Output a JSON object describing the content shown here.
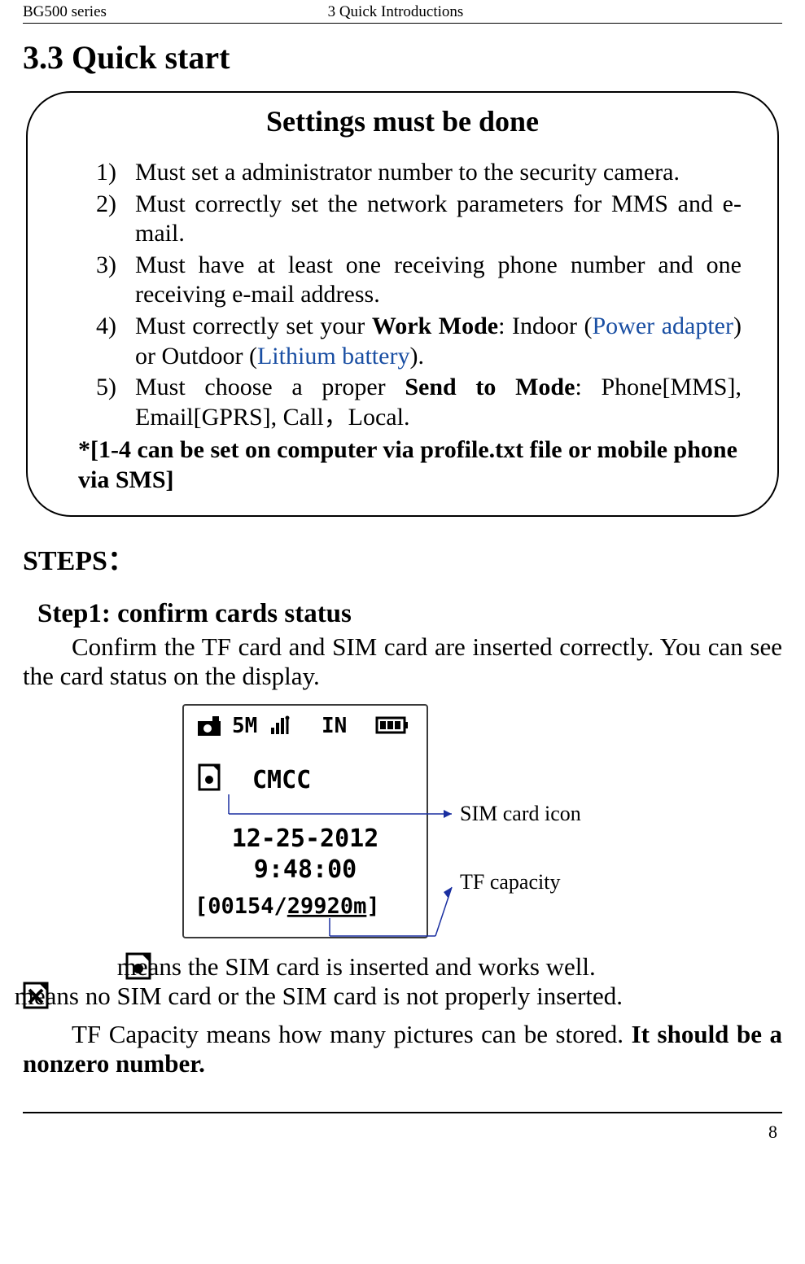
{
  "header": {
    "left": "BG500 series",
    "center": "3 Quick Introductions"
  },
  "section_heading": "3.3  Quick start",
  "callout": {
    "title": "Settings must be done",
    "items": [
      {
        "num": "1)",
        "pre": "Must set a administrator number to the security camera.",
        "bold": "",
        "post": ""
      },
      {
        "num": "2)",
        "pre": "Must correctly set the network parameters for MMS and e-mail.",
        "bold": "",
        "post": ""
      },
      {
        "num": "3)",
        "pre": "Must have at least one receiving phone number and one receiving e-mail address.",
        "bold": "",
        "post": ""
      },
      {
        "num": "4)",
        "pre": "Must correctly set your ",
        "bold": "Work Mode",
        "post": ": Indoor (",
        "link1": "Power adapter",
        "mid": ") or Outdoor (",
        "link2": "Lithium battery",
        "tail": ")."
      },
      {
        "num": "5)",
        "pre": "Must choose a proper ",
        "bold": "Send to Mode",
        "post": ": Phone[MMS], Email[GPRS], Call，Local."
      }
    ],
    "note": "*[1-4 can be set on computer via profile.txt file or mobile phone via SMS]"
  },
  "steps_head": "STEPS：",
  "step1": {
    "title": "Step1: confirm cards status",
    "para": "Confirm the TF card and SIM card are inserted correctly. You can see the card status on the display."
  },
  "diagram": {
    "top_row": {
      "res": "5M",
      "mode": "IN"
    },
    "carrier": "CMCC",
    "date": "12-25-2012",
    "time": "9:48:00",
    "counter_left": "[00154/",
    "counter_right": "29920m",
    "counter_close": "]",
    "label_sim": "SIM card icon",
    "label_tf": "TF capacity"
  },
  "after_diagram": {
    "line1_post": " means the SIM card is inserted and works well.",
    "line2_post": " means no SIM card or the SIM card is not properly inserted.",
    "para2_pre": "TF Capacity means how many pictures can be stored. ",
    "para2_bold": "It should be a nonzero number."
  },
  "page_number": "8"
}
